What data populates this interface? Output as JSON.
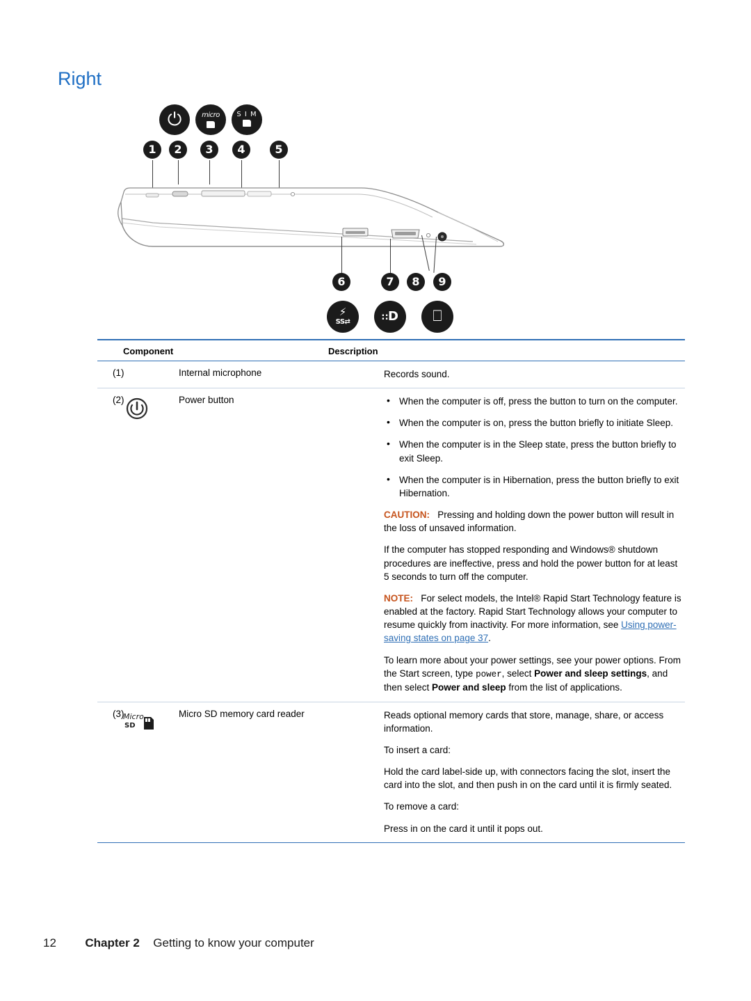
{
  "page": {
    "title": "Right",
    "footer_page_number": "12",
    "footer_chapter": "Chapter 2",
    "footer_chapter_title": "Getting to know your computer"
  },
  "illustration": {
    "name": "right-side-laptop-diagram",
    "callouts_top": [
      "1",
      "2",
      "3",
      "4",
      "5"
    ],
    "callouts_bottom": [
      "6",
      "7",
      "8",
      "9"
    ],
    "icons": [
      {
        "name": "power-icon",
        "glyph": "⏻"
      },
      {
        "name": "micro-sd-icon",
        "label": "micro"
      },
      {
        "name": "sim-card-icon",
        "label": "SIM"
      },
      {
        "name": "usb-charging-icon",
        "label": "SS⇄"
      },
      {
        "name": "displayport-icon",
        "label": "D"
      },
      {
        "name": "power-connector-icon",
        "label": "⚡"
      }
    ]
  },
  "table": {
    "headers": {
      "component": "Component",
      "description": "Description"
    },
    "rows": [
      {
        "num": "(1)",
        "icon": "",
        "name": "Internal microphone",
        "description_paragraphs": [
          "Records sound."
        ],
        "bullets": []
      },
      {
        "num": "(2)",
        "icon": "power-button-icon",
        "name": "Power button",
        "bullets": [
          "When the computer is off, press the button to turn on the computer.",
          "When the computer is on, press the button briefly to initiate Sleep.",
          "When the computer is in the Sleep state, press the button briefly to exit Sleep.",
          "When the computer is in Hibernation, press the button briefly to exit Hibernation."
        ],
        "caution_label": "CAUTION:",
        "caution_text": "Pressing and holding down the power button will result in the loss of unsaved information.",
        "para_after_caution": "If the computer has stopped responding and Windows® shutdown procedures are ineffective, press and hold the power button for at least 5 seconds to turn off the computer.",
        "note_label": "NOTE:",
        "note_text_1": "For select models, the Intel® Rapid Start Technology feature is enabled at the factory. Rapid Start Technology allows your computer to resume quickly from inactivity. For more information, see ",
        "note_link": "Using power-saving states on page 37",
        "note_text_2": ".",
        "final_text_1": "To learn more about your power settings, see your power options. From the Start screen, type ",
        "final_mono": "power",
        "final_text_2": ", select ",
        "final_bold_1": "Power and sleep settings",
        "final_text_3": ", and then select ",
        "final_bold_2": "Power and sleep",
        "final_text_4": " from the list of applications."
      },
      {
        "num": "(3)",
        "icon": "micro-sd-card-icon",
        "name": "Micro SD memory card reader",
        "description_paragraphs": [
          "Reads optional memory cards that store, manage, share, or access information.",
          "To insert a card:",
          "Hold the card label-side up, with connectors facing the slot, insert the card into the slot, and then push in on the card until it is firmly seated.",
          "To remove a card:",
          "Press in on the card it until it pops out."
        ],
        "bullets": []
      }
    ]
  },
  "colors": {
    "accent": "#2f6fb5",
    "title": "#1f6fc4",
    "caution": "#c6531c",
    "rule": "#c8d4e3"
  }
}
